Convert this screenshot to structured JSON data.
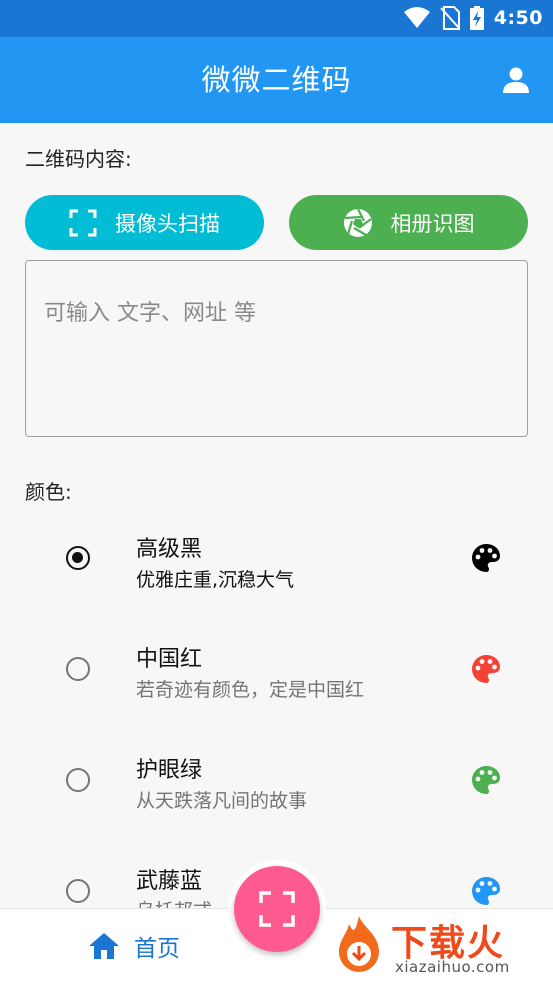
{
  "status_bar": {
    "time": "4:50",
    "icons": [
      "wifi-icon",
      "no-sim-icon",
      "battery-charging-icon"
    ]
  },
  "app_bar": {
    "title": "微微二维码",
    "user_icon": "person-icon"
  },
  "content": {
    "label": "二维码内容:",
    "scan_button": {
      "label": "摄像头扫描",
      "icon": "scan-frame-icon",
      "color": "#00bcd4"
    },
    "album_button": {
      "label": "相册识图",
      "icon": "aperture-icon",
      "color": "#4caf50"
    },
    "input": {
      "placeholder": "可输入 文字、网址 等",
      "value": ""
    }
  },
  "color_section": {
    "label": "颜色:",
    "options": [
      {
        "title": "高级黑",
        "subtitle": "优雅庄重,沉稳大气",
        "checked": true,
        "color": "#000000"
      },
      {
        "title": "中国红",
        "subtitle": "若奇迹有颜色，定是中国红",
        "checked": false,
        "color": "#f44336"
      },
      {
        "title": "护眼绿",
        "subtitle": "从天跌落凡间的故事",
        "checked": false,
        "color": "#4caf50"
      },
      {
        "title": "武藤蓝",
        "subtitle": "乌托邦式",
        "checked": false,
        "color": "#2196f3"
      }
    ]
  },
  "bottom_nav": {
    "home_label": "首页",
    "fab_icon": "scan-frame-icon",
    "fab_color": "#ff5a8f"
  },
  "watermark": {
    "brand": "下载火",
    "url": "xiazaihuo.com"
  }
}
